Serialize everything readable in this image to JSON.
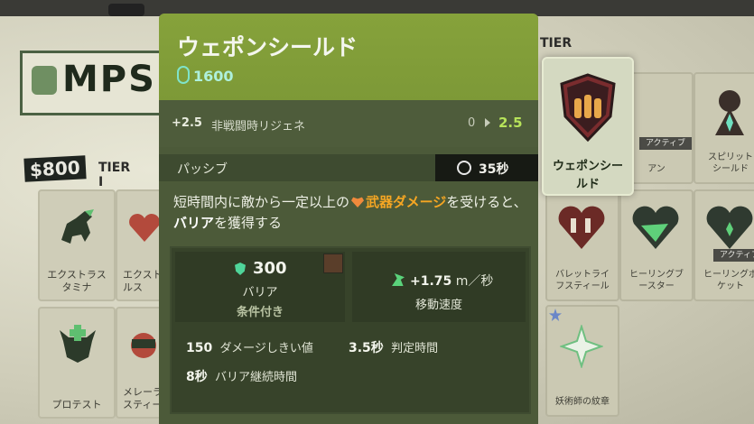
{
  "background": {
    "left_panel": {
      "mps_title": "MPS",
      "price": "$800",
      "tier": "TIER I",
      "cards": [
        {
          "label": "エクストラス\nタミナ",
          "icon": "horse-icon"
        },
        {
          "label": "エクスト\nルス",
          "icon": "heart-icon"
        },
        {
          "label": "プロテスト",
          "icon": "bull-icon"
        },
        {
          "label": "メレーラ\nスティー",
          "icon": "fist-icon"
        }
      ]
    },
    "right_panel": {
      "tier_partial": "TIER",
      "cards": [
        {
          "label": "",
          "tag": "アクティブ",
          "label2": "アン"
        },
        {
          "label": "スピリット\nシールド",
          "icon": "spirit-icon"
        },
        {
          "label": "バレットライ\nフスティール",
          "icon": "bullet-heart-icon"
        },
        {
          "label": "ヒーリングブ\nースター",
          "icon": "heart-plus-icon"
        },
        {
          "label": "ヒーリングボ\nケット",
          "tag": "アクティブ",
          "icon": "heart-pocket-icon"
        },
        {
          "label": "妖術師の紋章",
          "icon": "star-icon"
        }
      ]
    },
    "highlighted_card": {
      "label": "ウェポンシー\nルド",
      "icon": "bullet-shield-icon"
    }
  },
  "tooltip": {
    "title": "ウェポンシールド",
    "cost": "1600",
    "regen": {
      "bonus": "+2.5",
      "label": "非戦闘時リジェネ",
      "from": "0",
      "to": "2.5"
    },
    "passive_label": "パッシブ",
    "cooldown": "35秒",
    "description": {
      "part1": "短時間内に敵から一定以上の",
      "weapon_damage": "武器ダメージ",
      "part2": "を受けると、",
      "barrier": "バリア",
      "part3": "を獲得する"
    },
    "barrier_stat": {
      "value": "300",
      "label": "バリア",
      "condition": "条件付き"
    },
    "move_stat": {
      "value": "+1.75",
      "unit": "m／秒",
      "label": "移動速度"
    },
    "lines": [
      {
        "value": "150",
        "label": "ダメージしきい値"
      },
      {
        "value": "3.5秒",
        "label": "判定時間"
      },
      {
        "value": "8秒",
        "label": "バリア継続時間"
      }
    ]
  },
  "colors": {
    "header_green": "#86a23b",
    "body_green": "#4c5a39",
    "accent_orange": "#f5a623",
    "regen_green": "#b7e35a",
    "souls_teal": "#aef0dc"
  }
}
